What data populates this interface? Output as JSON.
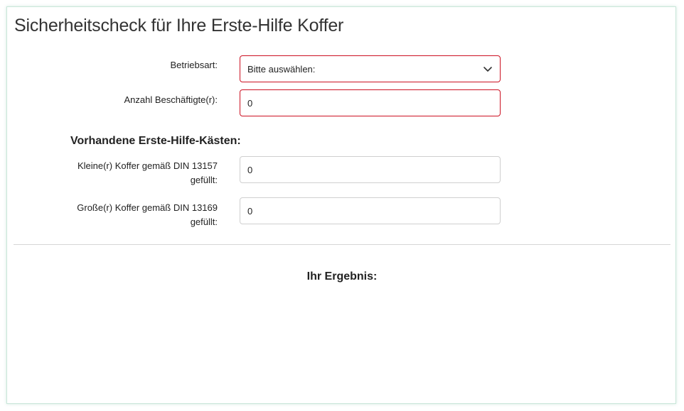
{
  "page": {
    "title": "Sicherheitscheck für Ihre Erste-Hilfe Koffer"
  },
  "form": {
    "betriebsart": {
      "label": "Betriebsart:",
      "selected": "Bitte auswählen:"
    },
    "beschaeftigte": {
      "label": "Anzahl Beschäftigte(r):",
      "value": "0"
    }
  },
  "kaesten": {
    "heading": "Vorhandene Erste-Hilfe-Kästen:",
    "klein": {
      "label_line1": "Kleine(r) Koffer gemäß DIN 13157",
      "label_line2": "gefüllt:",
      "value": "0"
    },
    "gross": {
      "label_line1": "Große(r) Koffer gemäß DIN 13169",
      "label_line2": "gefüllt:",
      "value": "0"
    }
  },
  "result": {
    "heading": "Ihr Ergebnis:"
  },
  "colors": {
    "invalid_border": "#cc1122",
    "normal_border": "#cfcfcf",
    "frame_border": "#c9e6d9"
  },
  "icons": {
    "select_caret": "chevron-down-icon"
  }
}
